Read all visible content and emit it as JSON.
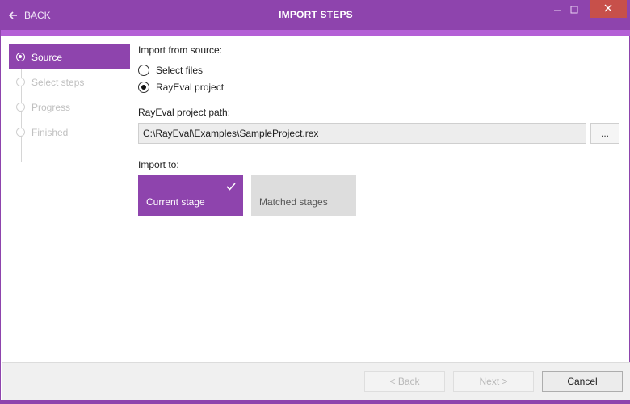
{
  "window": {
    "title": "IMPORT STEPS",
    "back_label": "BACK",
    "controls": [
      "minimize-icon",
      "maximize-icon",
      "close-icon"
    ],
    "accent_color": "#8e44ad",
    "accent_light": "#b45fd6",
    "close_color": "#c7504a"
  },
  "sidebar": {
    "steps": [
      {
        "label": "Source",
        "active": true
      },
      {
        "label": "Select steps",
        "active": false
      },
      {
        "label": "Progress",
        "active": false
      },
      {
        "label": "Finished",
        "active": false
      }
    ]
  },
  "main": {
    "source_label": "Import from source:",
    "source_options": [
      {
        "label": "Select files",
        "checked": false
      },
      {
        "label": "RayEval project",
        "checked": true
      }
    ],
    "path_label": "RayEval project path:",
    "path_value": "C:\\RayEval\\Examples\\SampleProject.rex",
    "browse_label": "...",
    "import_to_label": "Import to:",
    "import_targets": [
      {
        "label": "Current stage",
        "selected": true,
        "icon": "checkmark-icon"
      },
      {
        "label": "Matched stages",
        "selected": false
      }
    ]
  },
  "footer": {
    "back_label": "< Back",
    "next_label": "Next >",
    "cancel_label": "Cancel",
    "back_enabled": false,
    "next_enabled": false,
    "cancel_enabled": true
  }
}
